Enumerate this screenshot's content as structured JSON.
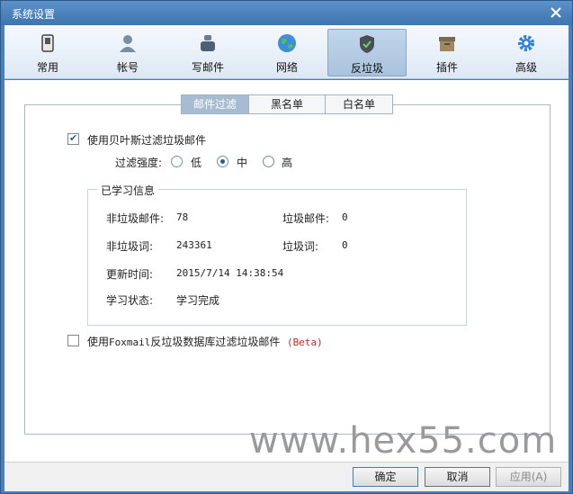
{
  "window": {
    "title": "系统设置",
    "close_icon": "close-icon"
  },
  "toolbar": {
    "items": [
      {
        "label": "常用",
        "icon": "phone-icon"
      },
      {
        "label": "帐号",
        "icon": "user-icon"
      },
      {
        "label": "写邮件",
        "icon": "inkwell-icon"
      },
      {
        "label": "网络",
        "icon": "globe-icon"
      },
      {
        "label": "反垃圾",
        "icon": "shield-icon"
      },
      {
        "label": "插件",
        "icon": "box-icon"
      },
      {
        "label": "高级",
        "icon": "gear-icon"
      }
    ],
    "active": "反垃圾"
  },
  "subtabs": {
    "items": [
      "邮件过滤",
      "黑名单",
      "白名单"
    ],
    "active": "邮件过滤"
  },
  "bayes": {
    "label": "使用贝叶斯过滤垃圾邮件",
    "checked": true
  },
  "strength": {
    "label": "过滤强度:",
    "options": [
      "低",
      "中",
      "高"
    ],
    "selected": "中"
  },
  "learned": {
    "title": "已学习信息",
    "nonspam_mail_label": "非垃圾邮件:",
    "nonspam_mail_value": "78",
    "spam_mail_label": "垃圾邮件:",
    "spam_mail_value": "0",
    "nonspam_word_label": "非垃圾词:",
    "nonspam_word_value": "243361",
    "spam_word_label": "垃圾词:",
    "spam_word_value": "0",
    "update_time_label": "更新时间:",
    "update_time_value": "2015/7/14 14:38:54",
    "status_label": "学习状态:",
    "status_value": "学习完成"
  },
  "foxmail_db": {
    "label_prefix": "使用",
    "label_brand": "Foxmail",
    "label_suffix": "反垃圾数据库过滤垃圾邮件",
    "beta": "(Beta)",
    "checked": false
  },
  "watermark": "www.hex55.com",
  "footer": {
    "ok": "确定",
    "cancel": "取消",
    "apply": "应用(A)"
  },
  "colors": {
    "titlebar": "#4a7fb8",
    "accent": "#2a5a9a",
    "beta": "#c62828"
  }
}
